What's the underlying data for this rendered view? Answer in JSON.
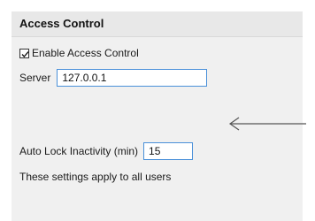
{
  "header": {
    "title": "Access Control"
  },
  "access_control": {
    "enabled_label": "Enable Access Control",
    "enabled_checked": true,
    "server_label": "Server",
    "server_value": "127.0.0.1",
    "auto_lock_label": "Auto Lock Inactivity (min)",
    "auto_lock_value": "15",
    "note": "These settings apply to all users"
  },
  "colors": {
    "panel_bg": "#f0f0f0",
    "header_bg": "#e8e8e8",
    "input_border": "#4a90d9",
    "arrow": "#555555"
  },
  "icons": [
    "checkmark-icon",
    "left-arrow-icon"
  ]
}
